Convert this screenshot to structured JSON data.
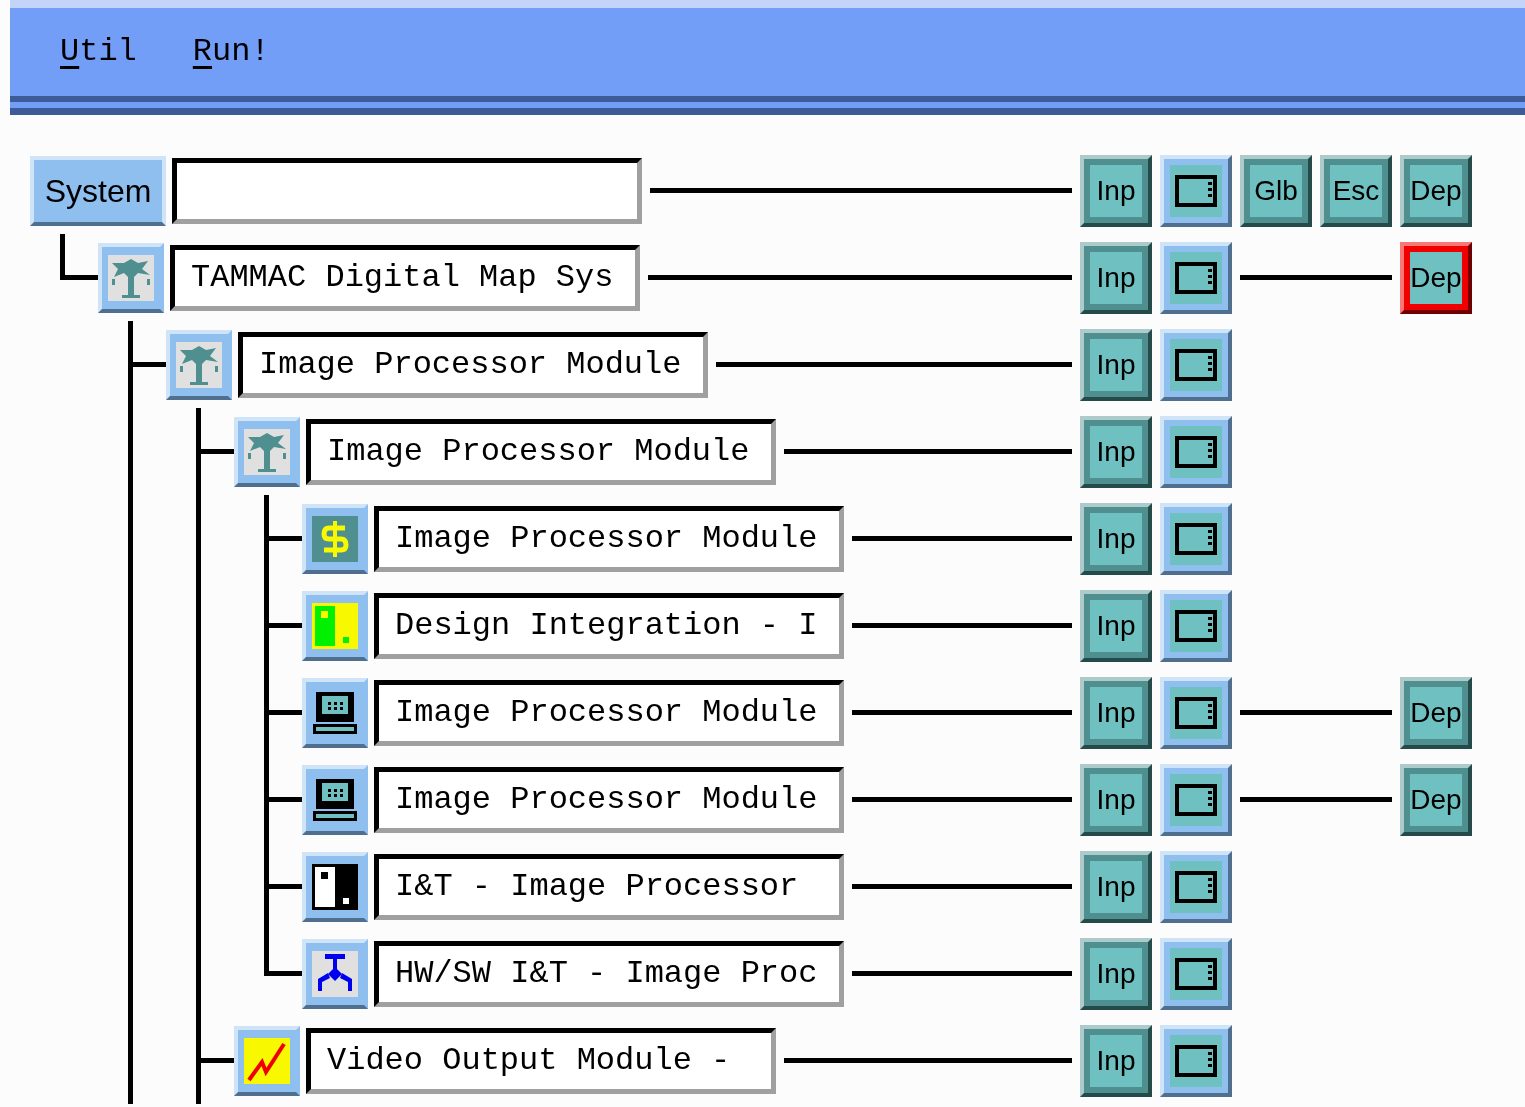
{
  "menu": [
    {
      "label": "Util"
    },
    {
      "label": "Run!"
    }
  ],
  "tree": {
    "label": "System",
    "continued": false,
    "buttons": [
      {
        "kind": "text",
        "label": "Inp"
      },
      {
        "kind": "frame"
      },
      {
        "kind": "text",
        "label": "Glb"
      },
      {
        "kind": "text",
        "label": "Esc"
      }
    ],
    "dep": {
      "label": "Dep",
      "alert": false
    },
    "children": [
      {
        "title": "TAMMAC Digital Map Sys",
        "kind": "tree",
        "continued": true,
        "buttons": [
          {
            "kind": "text",
            "label": "Inp"
          },
          {
            "kind": "frame"
          }
        ],
        "dep": {
          "label": "Dep",
          "alert": true
        },
        "children": [
          {
            "title": "Image Processor Module",
            "kind": "tree",
            "continued": true,
            "buttons": [
              {
                "kind": "text",
                "label": "Inp"
              },
              {
                "kind": "frame"
              }
            ],
            "children": [
              {
                "title": "Image Processor Module",
                "kind": "tree",
                "continued": false,
                "buttons": [
                  {
                    "kind": "text",
                    "label": "Inp"
                  },
                  {
                    "kind": "frame"
                  }
                ],
                "children": [
                  {
                    "title": "Image Processor Module",
                    "kind": "dollar",
                    "buttons": [
                      {
                        "kind": "text",
                        "label": "Inp"
                      },
                      {
                        "kind": "frame"
                      }
                    ]
                  },
                  {
                    "title": "Design Integration - I",
                    "kind": "green-panel",
                    "buttons": [
                      {
                        "kind": "text",
                        "label": "Inp"
                      },
                      {
                        "kind": "frame"
                      }
                    ]
                  },
                  {
                    "title": "Image Processor Module",
                    "kind": "computer",
                    "buttons": [
                      {
                        "kind": "text",
                        "label": "Inp"
                      },
                      {
                        "kind": "frame"
                      }
                    ],
                    "dep": {
                      "label": "Dep",
                      "alert": false
                    }
                  },
                  {
                    "title": "Image Processor Module",
                    "kind": "computer",
                    "buttons": [
                      {
                        "kind": "text",
                        "label": "Inp"
                      },
                      {
                        "kind": "frame"
                      }
                    ],
                    "dep": {
                      "label": "Dep",
                      "alert": false
                    }
                  },
                  {
                    "title": "I&T - Image Processor",
                    "kind": "bw-panel",
                    "buttons": [
                      {
                        "kind": "text",
                        "label": "Inp"
                      },
                      {
                        "kind": "frame"
                      }
                    ]
                  },
                  {
                    "title": "HW/SW I&T - Image Proc",
                    "kind": "claw",
                    "buttons": [
                      {
                        "kind": "text",
                        "label": "Inp"
                      },
                      {
                        "kind": "frame"
                      }
                    ]
                  }
                ]
              },
              {
                "title": "Video Output Module -",
                "kind": "zigzag",
                "buttons": [
                  {
                    "kind": "text",
                    "label": "Inp"
                  },
                  {
                    "kind": "frame"
                  }
                ]
              }
            ]
          }
        ]
      }
    ]
  }
}
